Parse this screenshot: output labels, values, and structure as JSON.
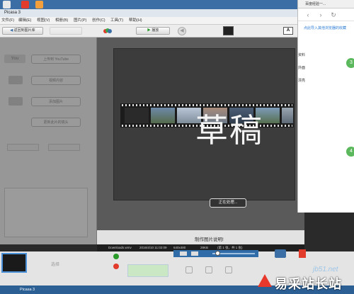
{
  "window": {
    "title": "Picasa 3"
  },
  "menu": [
    "文件(F)",
    "编辑(E)",
    "视图(V)",
    "相册(B)",
    "图片(P)",
    "创作(C)",
    "工具(T)",
    "帮助(H)"
  ],
  "toolbar": {
    "back_label": "返回到图片库",
    "play_label": "播放"
  },
  "left_panel": {
    "youtube_label": "上传到 YouTube",
    "btn2_label": "视频内容",
    "btn3_label": "添加图片",
    "btn4_label": "更新此片的镜头"
  },
  "preview": {
    "watermark_text": "草稿",
    "processing_label": "正在处理..."
  },
  "caption": "制作图片说明!",
  "info_bar": {
    "file_name": "Downloads.wmv",
    "timestamp": "2016/4/10 11:02:09",
    "resolution": "640x480",
    "size": "28KB",
    "counter": "(第 1 张，共 1 张)"
  },
  "bottom": {
    "tray_label": "选择",
    "status_label": "Picasa 3"
  },
  "side_panel": {
    "tab_title": "百度经验一...",
    "link_text": "点此导入其他浏览器的收藏",
    "items": [
      "资料",
      "外面",
      "漂亮"
    ],
    "steps": [
      "3",
      "4"
    ]
  },
  "logo": {
    "text": "易采站长站",
    "url": "jb51.net"
  },
  "colors": {
    "accent": "#3b6ea5",
    "preview_bg": "#3c3c3c",
    "step_green": "#5cb85c",
    "logo_red": "#e8382c"
  }
}
